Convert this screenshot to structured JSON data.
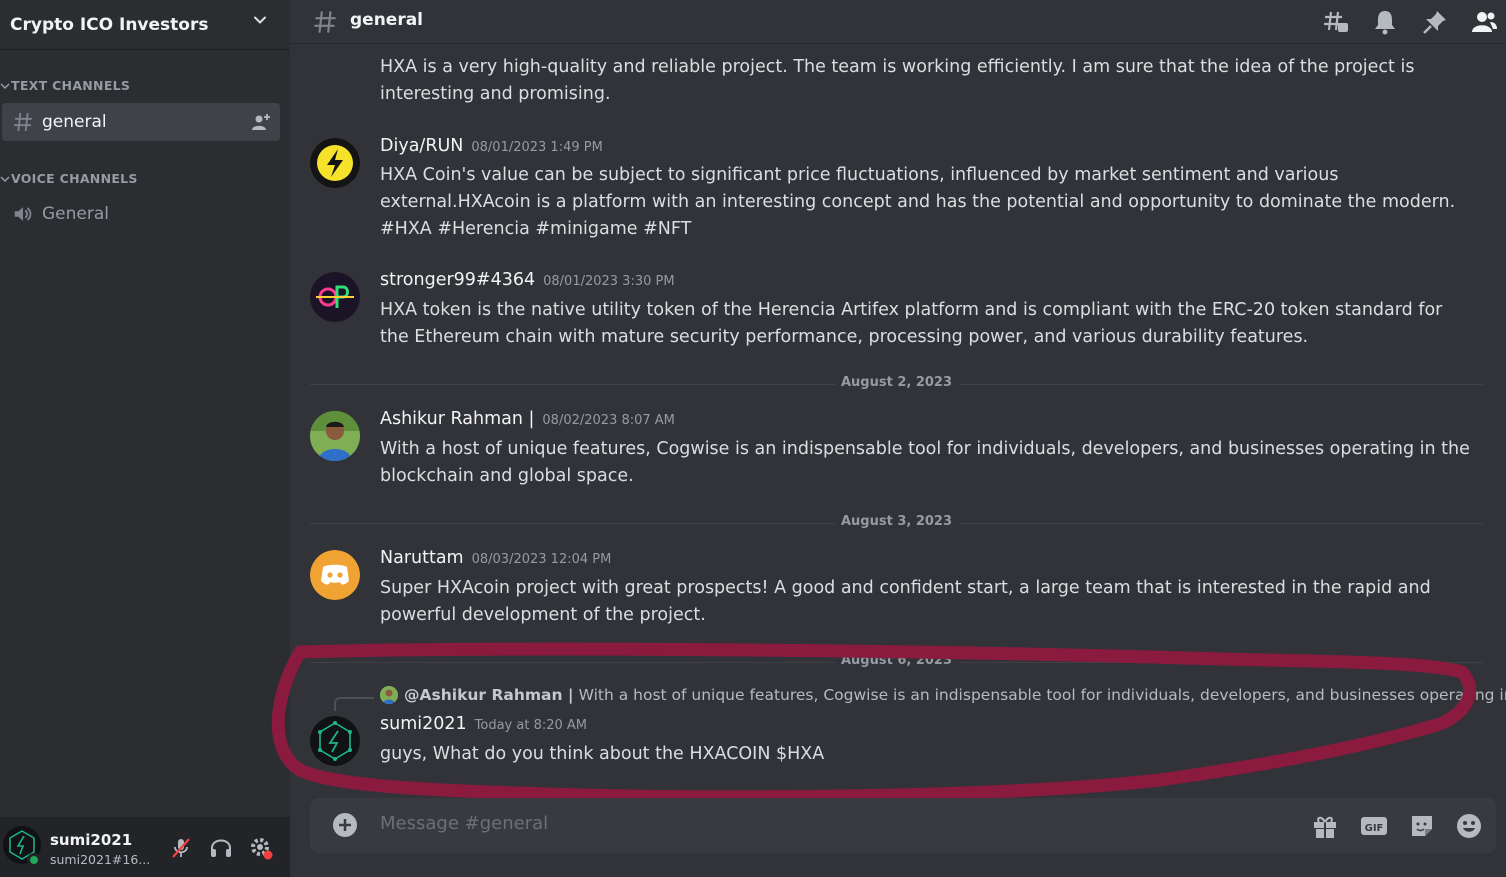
{
  "server": {
    "name": "Crypto ICO Investors"
  },
  "sidebar": {
    "text_category": "TEXT CHANNELS",
    "voice_category": "VOICE CHANNELS",
    "text_channels": [
      {
        "label": "general",
        "active": true
      }
    ],
    "voice_channels": [
      {
        "label": "General"
      }
    ]
  },
  "user": {
    "name": "sumi2021",
    "tag": "sumi2021#16...",
    "status": "online"
  },
  "channel": {
    "name": "general"
  },
  "messages": [
    {
      "author": "",
      "timestamp": "",
      "lines": [
        "HXA is a very high-quality and reliable project. The team is working efficiently. I am sure that the idea of the project is",
        "interesting and promising."
      ]
    },
    {
      "author": "Diya/RUN",
      "timestamp": "08/01/2023 1:49 PM",
      "lines": [
        "HXA Coin's value can be subject to significant price fluctuations, influenced by market sentiment and various",
        "external.HXAcoin is a platform with an interesting concept and has the potential and opportunity to dominate the modern.",
        "#HXA #Herencia #minigame #NFT"
      ]
    },
    {
      "author": "stronger99#4364",
      "timestamp": "08/01/2023 3:30 PM",
      "lines": [
        "HXA token is the native utility token of the Herencia Artifex platform and is compliant with the ERC-20 token standard for",
        "the Ethereum chain with mature security performance, processing power, and various durability features."
      ]
    },
    {
      "author": "Ashikur Rahman |",
      "timestamp": "08/02/2023 8:07 AM",
      "lines": [
        "With a host of unique features, Cogwise is an indispensable tool for individuals, developers, and businesses operating in the",
        "blockchain and global space."
      ]
    },
    {
      "author": "Naruttam",
      "timestamp": "08/03/2023 12:04 PM",
      "lines": [
        "Super HXAcoin project with great prospects! A good and confident start, a large team that is interested in the rapid and",
        "powerful development of the project."
      ]
    },
    {
      "author": "sumi2021",
      "timestamp": "Today at 8:20 AM",
      "lines": [
        "guys, What do you think about the HXACOIN $HXA"
      ],
      "reply": {
        "author": "@Ashikur Rahman |",
        "text": "With a host of unique features, Cogwise is an indispensable tool for individuals, developers, and businesses operating in"
      }
    }
  ],
  "dividers": [
    "August 2, 2023",
    "August 3, 2023",
    "August 6, 2023"
  ],
  "composer": {
    "placeholder": "Message #general"
  },
  "colors": {
    "background": "#313338",
    "sidebar": "#2b2d31",
    "annotation": "#8b1a3f",
    "online": "#23a55a"
  }
}
